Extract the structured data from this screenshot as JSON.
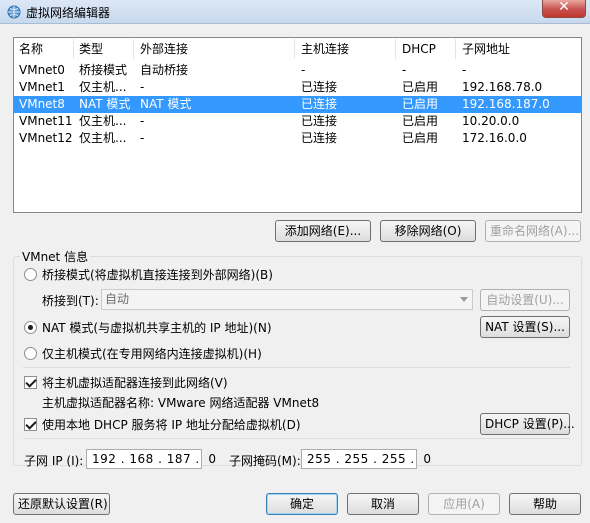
{
  "window": {
    "title": "虚拟网络编辑器",
    "close_glyph": "✕"
  },
  "network_list": {
    "columns": [
      "名称",
      "类型",
      "外部连接",
      "主机连接",
      "DHCP",
      "子网地址"
    ],
    "rows": [
      {
        "name": "VMnet0",
        "type": "桥接模式",
        "external": "自动桥接",
        "host": "-",
        "dhcp": "-",
        "subnet": "-"
      },
      {
        "name": "VMnet1",
        "type": "仅主机...",
        "external": "-",
        "host": "已连接",
        "dhcp": "已启用",
        "subnet": "192.168.78.0"
      },
      {
        "name": "VMnet8",
        "type": "NAT 模式",
        "external": "NAT 模式",
        "host": "已连接",
        "dhcp": "已启用",
        "subnet": "192.168.187.0"
      },
      {
        "name": "VMnet11",
        "type": "仅主机...",
        "external": "-",
        "host": "已连接",
        "dhcp": "已启用",
        "subnet": "10.20.0.0"
      },
      {
        "name": "VMnet12",
        "type": "仅主机...",
        "external": "-",
        "host": "已连接",
        "dhcp": "已启用",
        "subnet": "172.16.0.0"
      }
    ],
    "selected_index": 2
  },
  "list_buttons": {
    "add": "添加网络(E)...",
    "remove": "移除网络(O)",
    "rename": "重命名网络(A)..."
  },
  "vmnet_info": {
    "group_title": "VMnet 信息",
    "bridged_radio": "桥接模式(将虚拟机直接连接到外部网络)(B)",
    "bridge_to_label": "桥接到(T):",
    "bridge_to_value": "自动",
    "auto_settings_button": "自动设置(U)...",
    "nat_radio": "NAT 模式(与虚拟机共享主机的 IP 地址)(N)",
    "nat_settings_button": "NAT 设置(S)...",
    "hostonly_radio": "仅主机模式(在专用网络内连接虚拟机)(H)",
    "selected_mode": "nat",
    "connect_adapter_check": "将主机虚拟适配器连接到此网络(V)",
    "connect_adapter_checked": true,
    "adapter_name_text": "主机虚拟适配器名称: VMware 网络适配器 VMnet8",
    "dhcp_check": "使用本地 DHCP 服务将 IP 地址分配给虚拟机(D)",
    "dhcp_checked": true,
    "dhcp_settings_button": "DHCP 设置(P)...",
    "subnet_ip_label": "子网 IP (I):",
    "subnet_ip_value": "192 . 168 . 187 .  0",
    "subnet_mask_label": "子网掩码(M):",
    "subnet_mask_value": "255 . 255 . 255 .  0"
  },
  "footer_buttons": {
    "restore_defaults": "还原默认设置(R)",
    "ok": "确定",
    "cancel": "取消",
    "apply": "应用(A)",
    "help": "帮助"
  }
}
